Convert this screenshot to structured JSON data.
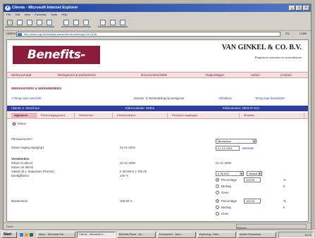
{
  "window": {
    "title": "Clients - Microsoft Internet Explorer",
    "minimize": "_",
    "maximize": "□",
    "close": "×"
  },
  "menu": [
    "File",
    "Edit",
    "View",
    "Favorites",
    "Tools",
    "Help"
  ],
  "address": {
    "label": "Address",
    "url": "http://www.vgd.nl/benefits-plaza/clients/client.asp?id=2145",
    "go": "Go",
    "links": "Links"
  },
  "site": {
    "logo": "Benefits-Plaza",
    "firm_name": "VAN GINKEL & CO. B.V.",
    "firm_tagline": "Registeraccountants en assuradeuren",
    "nav": [
      "Werkvoorraad",
      "Werkgevers & werknemers",
      "Documenten/WEB",
      "Rapportages",
      "Admin",
      "Contact"
    ],
    "breadcrumb": "WERKGEVERS & WERKNEMERS",
    "row": {
      "left": "< Terug naar overzicht",
      "mid": "Dossier: In behandeling bij werkgever",
      "right_a": "Afdrukken",
      "right_b": "Terug naar bovenkant"
    },
    "bluebar": {
      "a": "Clients: A. Verschoor",
      "b": "Klant nummer: 20451",
      "c": "Polisnummer: 2004-07-012"
    },
    "tabs": [
      "Algemeen",
      "Persoonsgegevens",
      "Werknemer",
      "Dienstverband",
      "Pensioen regelingen",
      "Mutaties"
    ],
    "close_label": "Sluiten"
  },
  "form": {
    "f1": {
      "label": "Pensioenvorm?",
      "select": "Middelloon"
    },
    "f2": {
      "label": "Datum ingang wijziging?",
      "value": "01-01-2004",
      "input": "01-01-2004",
      "link": "kalender"
    },
    "section": "Verzekerden",
    "f3": {
      "label": "Datum in dienst",
      "value": "01-01-1999",
      "right": "01-01-1999"
    },
    "f4": {
      "label": "Datum uit dienst",
      "value": ""
    },
    "f5": {
      "label": "Salaris (b.v. Salarissen Prismet)",
      "value": "€ 35.000 € 1.750,00",
      "select_a": "€ 35.000",
      "select_b": "Maand"
    },
    "f6": {
      "label": "Deeltijdfactor",
      "value": "100 %"
    },
    "radio_group_1": [
      {
        "label": "Percentage",
        "on": true,
        "input": "100,00",
        "unit": "%"
      },
      {
        "label": "Bedrag",
        "on": false,
        "unit": "€"
      },
      {
        "label": "Geen",
        "on": false
      }
    ],
    "f7": {
      "label": "Deelnemers",
      "value": "100,00 %"
    },
    "radio_group_2": [
      {
        "label": "Percentage",
        "on": true,
        "input": "100,00",
        "unit": "%"
      },
      {
        "label": "Bedrag",
        "on": false,
        "unit": "€"
      },
      {
        "label": "Geen",
        "on": false
      }
    ]
  },
  "statusbar": {
    "text": "Done",
    "zone": "Internet"
  },
  "taskbar": {
    "start": "Start",
    "tasks": [
      "Inbox - Microsoft Out...",
      "Clients - Microsoft In...",
      "Benefits Plaza - Mi...",
      "Document1 - Micr...",
      "Exploring - Files",
      "Adobe Photoshop"
    ],
    "clock": "10:25"
  }
}
